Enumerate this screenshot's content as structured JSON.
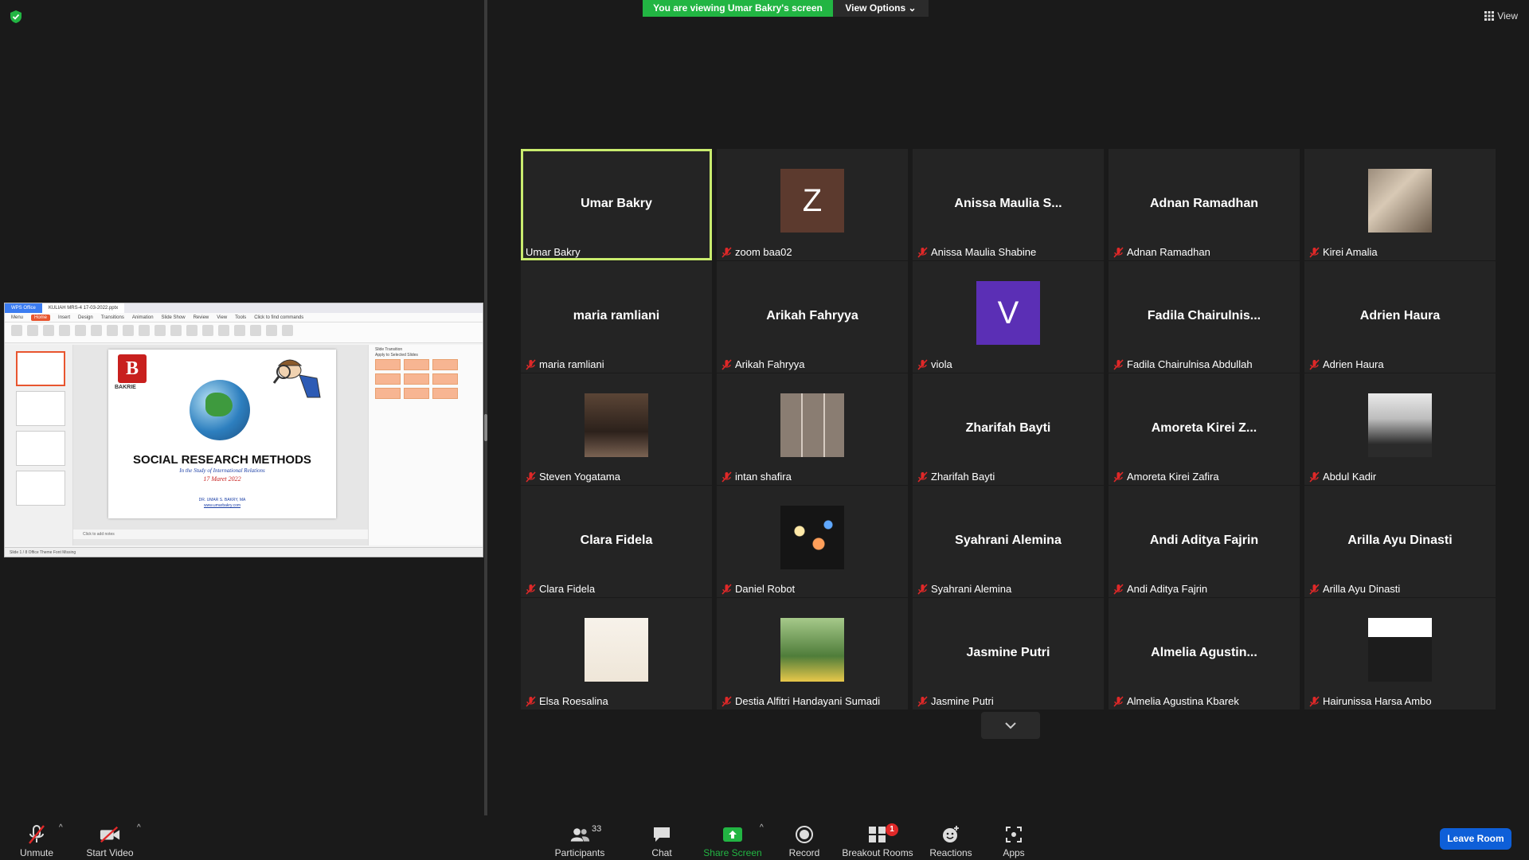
{
  "banner": {
    "viewing_text": "You are viewing Umar Bakry's screen",
    "view_options": "View Options",
    "view_label": "View"
  },
  "shared_screen": {
    "app_tab": "WPS Office",
    "doc_tab": "KULIAH MRS-4 17-03-2022.pptx",
    "menu": [
      "Menu",
      "Home",
      "Insert",
      "Design",
      "Transitions",
      "Animation",
      "Slide Show",
      "Review",
      "View",
      "Tools",
      "Click to find commands"
    ],
    "slide_logo_letter": "B",
    "slide_logo_text": "BAKRIE",
    "slide_title": "SOCIAL RESEARCH METHODS",
    "slide_subtitle": "In the Study of International Relations",
    "slide_date": "17 Maret 2022",
    "slide_author": "DR. UMAR S. BAKRY, MA",
    "slide_url": "www.umarbakry.com",
    "notes_placeholder": "Click to add notes",
    "pane_title": "Slide Transition",
    "pane_apply": "Apply to Selected Slides",
    "status_text": "Slide 1 / 8   Office Theme   Font Missing"
  },
  "gallery": {
    "tiles": [
      {
        "big": "Umar Bakry",
        "caption": "Umar Bakry",
        "muted": false,
        "avatar": null
      },
      {
        "big": "",
        "caption": "zoom baa02",
        "muted": true,
        "avatar": {
          "type": "letter",
          "letter": "Z",
          "color": "#5c3a2e"
        }
      },
      {
        "big": "Anissa  Maulia  S...",
        "caption": "Anissa Maulia Shabine",
        "muted": true,
        "avatar": null
      },
      {
        "big": "Adnan Ramadhan",
        "caption": "Adnan Ramadhan",
        "muted": true,
        "avatar": null
      },
      {
        "big": "",
        "caption": "Kirei Amalia",
        "muted": true,
        "avatar": {
          "type": "photo",
          "tone": "building"
        }
      },
      {
        "big": "maria ramliani",
        "caption": "maria ramliani",
        "muted": true,
        "avatar": null
      },
      {
        "big": "Arikah Fahryya",
        "caption": "Arikah Fahryya",
        "muted": true,
        "avatar": null
      },
      {
        "big": "",
        "caption": "viola",
        "muted": true,
        "avatar": {
          "type": "letter",
          "letter": "V",
          "color": "#5b2fb5"
        }
      },
      {
        "big": "Fadila  Chairulnis...",
        "caption": "Fadila Chairulnisa Abdullah",
        "muted": true,
        "avatar": null
      },
      {
        "big": "Adrien Haura",
        "caption": "Adrien Haura",
        "muted": true,
        "avatar": null
      },
      {
        "big": "",
        "caption": "Steven Yogatama",
        "muted": true,
        "avatar": {
          "type": "photo",
          "tone": "brown"
        }
      },
      {
        "big": "",
        "caption": "intan shafira",
        "muted": true,
        "avatar": {
          "type": "photo",
          "tone": "collage"
        }
      },
      {
        "big": "Zharifah Bayti",
        "caption": "Zharifah Bayti",
        "muted": true,
        "avatar": null
      },
      {
        "big": "Amoreta  Kirei  Z...",
        "caption": "Amoreta Kirei Zafira",
        "muted": true,
        "avatar": null
      },
      {
        "big": "",
        "caption": "Abdul Kadir",
        "muted": true,
        "avatar": {
          "type": "photo",
          "tone": "face"
        }
      },
      {
        "big": "Clara Fidela",
        "caption": "Clara Fidela",
        "muted": true,
        "avatar": null
      },
      {
        "big": "",
        "caption": "Daniel Robot",
        "muted": true,
        "avatar": {
          "type": "photo",
          "tone": "bokeh"
        }
      },
      {
        "big": "Syahrani Alemina",
        "caption": "Syahrani Alemina",
        "muted": true,
        "avatar": null
      },
      {
        "big": "Andi Aditya Fajrin",
        "caption": "Andi Aditya Fajrin",
        "muted": true,
        "avatar": null
      },
      {
        "big": "Arilla Ayu Dinasti",
        "caption": "Arilla Ayu Dinasti",
        "muted": true,
        "avatar": null
      },
      {
        "big": "",
        "caption": "Elsa Roesalina",
        "muted": true,
        "avatar": {
          "type": "photo",
          "tone": "floral"
        }
      },
      {
        "big": "",
        "caption": "Destia Alfitri Handayani Sumadi",
        "muted": true,
        "avatar": {
          "type": "photo",
          "tone": "green"
        }
      },
      {
        "big": "Jasmine Putri",
        "caption": "Jasmine Putri",
        "muted": true,
        "avatar": null
      },
      {
        "big": "Almelia  Agustin...",
        "caption": "Almelia Agustina Kbarek",
        "muted": true,
        "avatar": null
      },
      {
        "big": "",
        "caption": "Hairunissa Harsa Ambo",
        "muted": true,
        "avatar": {
          "type": "photo",
          "tone": "hijab"
        }
      }
    ]
  },
  "toolbar": {
    "unmute": "Unmute",
    "start_video": "Start Video",
    "participants": "Participants",
    "participants_count": "33",
    "chat": "Chat",
    "share_screen": "Share Screen",
    "record": "Record",
    "breakout_rooms": "Breakout Rooms",
    "breakout_badge": "1",
    "reactions": "Reactions",
    "apps": "Apps",
    "leave_room": "Leave Room"
  },
  "colors": {
    "banner_green": "#22b543",
    "active_speaker_border": "#c9ec6e",
    "leave_blue": "#0e5fd8",
    "mute_red": "#e02828"
  }
}
